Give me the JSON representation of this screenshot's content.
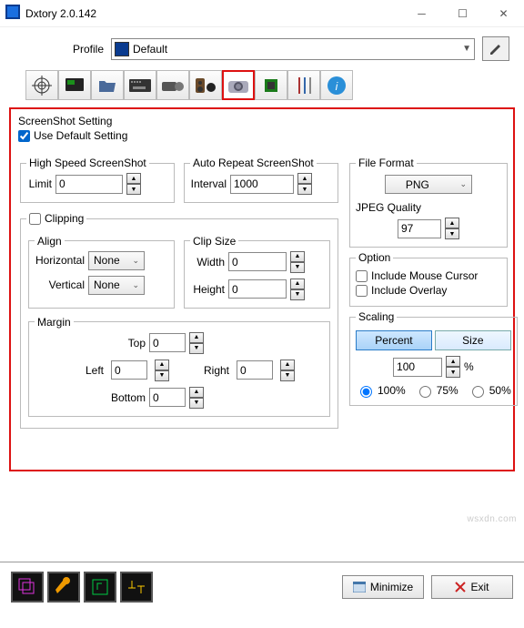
{
  "window": {
    "title": "Dxtory 2.0.142"
  },
  "profile": {
    "label": "Profile",
    "selected": "Default"
  },
  "screenshot": {
    "title": "ScreenShot Setting",
    "use_default": "Use Default Setting",
    "use_default_checked": true,
    "high_speed": {
      "legend": "High Speed ScreenShot",
      "limit_label": "Limit",
      "limit": "0"
    },
    "auto_repeat": {
      "legend": "Auto Repeat ScreenShot",
      "interval_label": "Interval",
      "interval": "1000"
    },
    "clipping": {
      "legend": "Clipping",
      "align": {
        "legend": "Align",
        "h_label": "Horizontal",
        "h_value": "None",
        "v_label": "Vertical",
        "v_value": "None"
      },
      "size": {
        "legend": "Clip Size",
        "w_label": "Width",
        "w_value": "0",
        "h_label": "Height",
        "h_value": "0"
      },
      "margin": {
        "legend": "Margin",
        "top_label": "Top",
        "top": "0",
        "left_label": "Left",
        "left": "0",
        "right_label": "Right",
        "right": "0",
        "bottom_label": "Bottom",
        "bottom": "0"
      }
    },
    "file_format": {
      "legend": "File Format",
      "format": "PNG",
      "jpeg_label": "JPEG Quality",
      "jpeg_value": "97"
    },
    "option": {
      "legend": "Option",
      "mouse": "Include Mouse Cursor",
      "overlay": "Include Overlay"
    },
    "scaling": {
      "legend": "Scaling",
      "percent": "Percent",
      "size": "Size",
      "value": "100",
      "unit": "%",
      "r100": "100%",
      "r75": "75%",
      "r50": "50%"
    }
  },
  "bottom": {
    "minimize": "Minimize",
    "exit": "Exit"
  }
}
